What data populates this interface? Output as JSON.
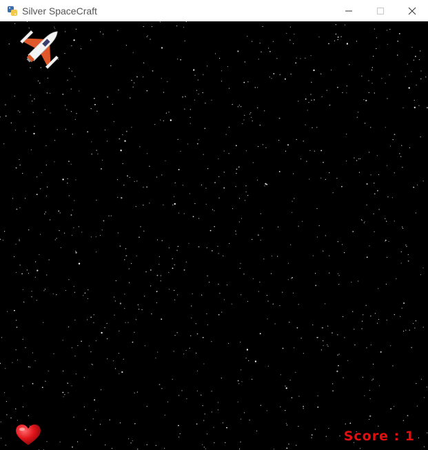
{
  "window": {
    "title": "Silver SpaceCraft",
    "app_icon": "python-icon",
    "controls": {
      "minimize_icon": "minimize-icon",
      "maximize_icon": "maximize-icon",
      "close_icon": "close-icon"
    }
  },
  "game": {
    "background_color": "#000000",
    "player_ship_icon": "spaceship-icon",
    "lives_icon": "heart-icon",
    "score_text": "Score : 1",
    "score_color": "#e01010"
  }
}
